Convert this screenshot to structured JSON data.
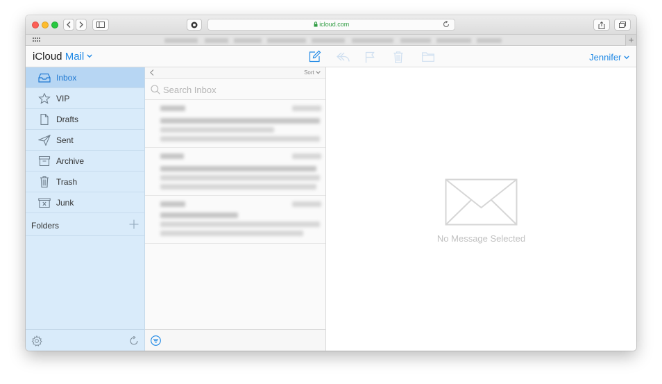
{
  "browser": {
    "url": "icloud.com",
    "new_tab_label": "+"
  },
  "app": {
    "brand_prefix": "iCloud",
    "brand_name": "Mail",
    "user_name": "Jennifer"
  },
  "sidebar": {
    "items": [
      {
        "label": "Inbox",
        "icon": "inbox-icon",
        "active": true
      },
      {
        "label": "VIP",
        "icon": "star-icon"
      },
      {
        "label": "Drafts",
        "icon": "document-icon"
      },
      {
        "label": "Sent",
        "icon": "paper-plane-icon"
      },
      {
        "label": "Archive",
        "icon": "archive-box-icon"
      },
      {
        "label": "Trash",
        "icon": "trash-icon"
      },
      {
        "label": "Junk",
        "icon": "junk-box-icon"
      }
    ],
    "folders_label": "Folders"
  },
  "message_list": {
    "sort_label": "Sort",
    "search_placeholder": "Search Inbox"
  },
  "detail": {
    "empty_text": "No Message Selected"
  },
  "colors": {
    "accent": "#1e88e5",
    "sidebar_bg": "#d9ebfa",
    "sidebar_active": "#b7d6f3"
  }
}
